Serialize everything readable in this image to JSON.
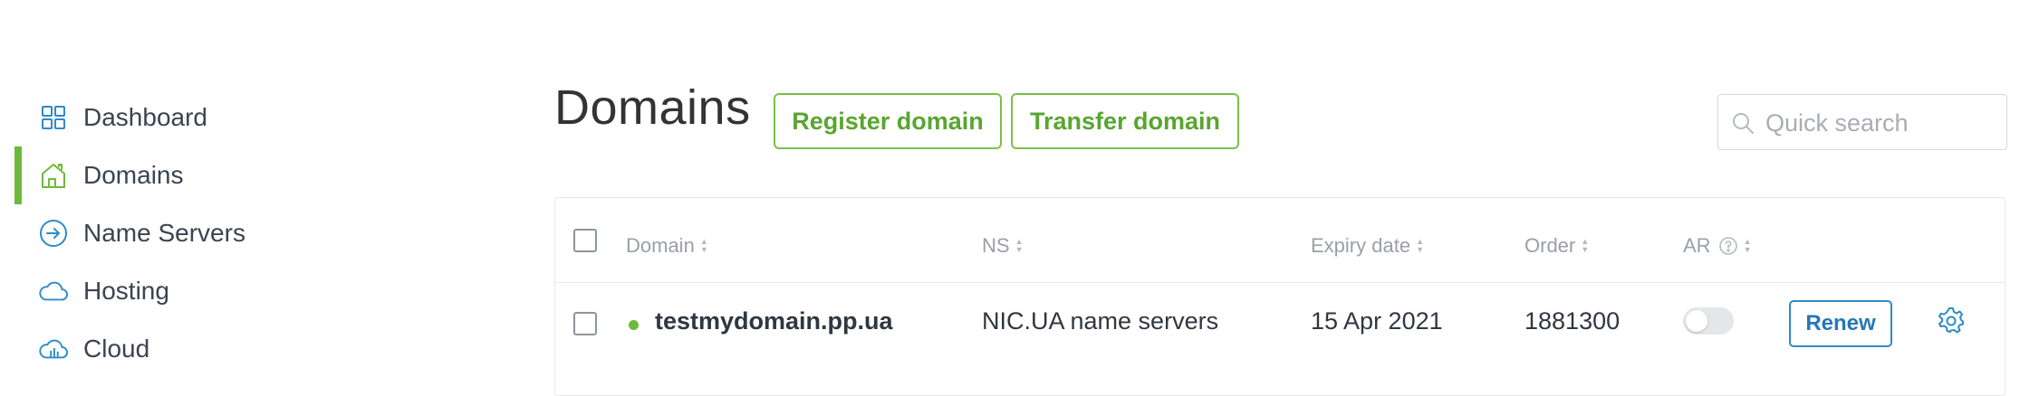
{
  "sidebar": {
    "items": [
      {
        "label": "Dashboard",
        "icon": "grid-icon",
        "active": false
      },
      {
        "label": "Domains",
        "icon": "house-icon",
        "active": true
      },
      {
        "label": "Name Servers",
        "icon": "arrow-circle-icon",
        "active": false
      },
      {
        "label": "Hosting",
        "icon": "cloud-icon",
        "active": false
      },
      {
        "label": "Cloud",
        "icon": "cloud-server-icon",
        "active": false
      }
    ]
  },
  "header": {
    "title": "Domains",
    "register_label": "Register domain",
    "transfer_label": "Transfer domain",
    "search_placeholder": "Quick search"
  },
  "table": {
    "columns": [
      "Domain",
      "NS",
      "Expiry date",
      "Order",
      "AR"
    ],
    "rows": [
      {
        "domain": "testmydomain.pp.ua",
        "ns": "NIC.UA name servers",
        "expiry": "15 Apr 2021",
        "order": "1881300",
        "auto_renew": false,
        "renew_label": "Renew"
      }
    ]
  },
  "colors": {
    "accent_green": "#6cba3c",
    "accent_blue": "#2e8bc9"
  }
}
